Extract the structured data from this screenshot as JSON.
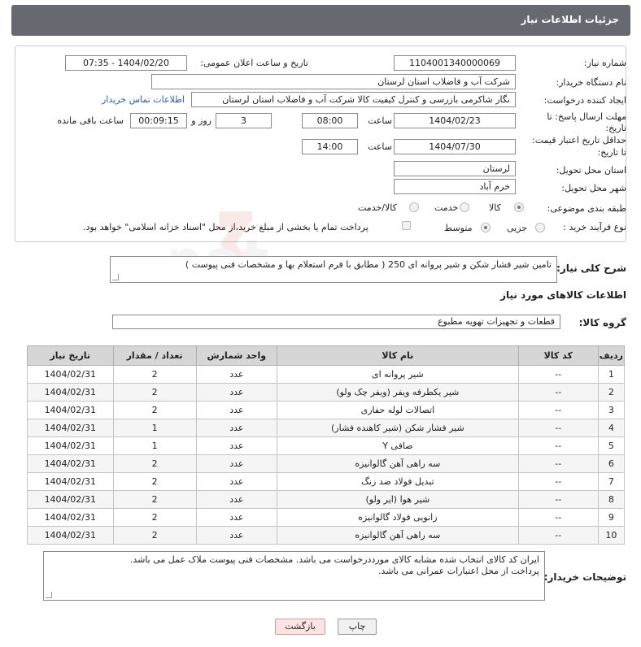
{
  "header": {
    "title": "جزئیات اطلاعات نیاز"
  },
  "form": {
    "need_number_label": "شماره نیاز:",
    "need_number": "1104001340000069",
    "announce_label": "تاریخ و ساعت اعلان عمومی:",
    "announce_value": "1404/02/20 - 07:35",
    "buyer_org_label": "نام دستگاه خریدار:",
    "buyer_org": "شرکت آب و فاضلاب استان لرستان",
    "requester_label": "ایجاد کننده درخواست:",
    "requester": "نگار شاکرمی بازرسی و کنترل کیفیت کالا شرکت آب و فاضلاب استان لرستان",
    "buyer_contact_link": "اطلاعات تماس خریدار",
    "deadline_label_1": "مهلت ارسال پاسخ: تا",
    "deadline_label_2": "تاریخ:",
    "deadline_date": "1404/02/23",
    "time_label": "ساعت",
    "deadline_time": "08:00",
    "days_value": "3",
    "days_label": "روز و",
    "remaining_time": "00:09:15",
    "remaining_label": "ساعت باقی مانده",
    "min_price_label_1": "حداقل تاریخ اعتبار قیمت:",
    "min_price_label_2": "تا تاریخ:",
    "min_price_date": "1404/07/30",
    "min_price_time": "14:00",
    "province_label": "استان محل تحویل:",
    "province": "لرستان",
    "city_label": "شهر محل تحویل:",
    "city": "خرم آباد",
    "category_label": "طبقه بندی موضوعی:",
    "category_options": [
      "کالا",
      "خدمت",
      "کالا/خدمت"
    ],
    "category_selected": "کالا",
    "process_label": "نوع فرآیند خرید :",
    "process_options": [
      "جزیی",
      "متوسط"
    ],
    "process_selected": "متوسط",
    "payment_note": "پرداخت تمام یا بخشی از مبلغ خرید،از محل \"اسناد خزانه اسلامی\" خواهد بود."
  },
  "description": {
    "label": "شرح کلی نیاز:",
    "text": "تامین شیر فشار شکن و شیر پروانه ای 250 ( مطابق با فرم استعلام بها و مشخصات فنی پیوست )"
  },
  "goods_section": {
    "title": "اطلاعات کالاهای مورد نیاز",
    "group_label": "گروه کالا:",
    "group_value": "قطعات و تجهیزات تهویه مطبوع"
  },
  "table": {
    "headers": [
      "ردیف",
      "کد کالا",
      "نام کالا",
      "واحد شمارش",
      "تعداد / مقدار",
      "تاریخ نیاز"
    ],
    "rows": [
      [
        "1",
        "--",
        "شیر پروانه ای",
        "عدد",
        "2",
        "1404/02/31"
      ],
      [
        "2",
        "--",
        "شیر یکطرفه ویفر (ویفر چک ولو)",
        "عدد",
        "2",
        "1404/02/31"
      ],
      [
        "3",
        "--",
        "اتصالات لوله حفاری",
        "عدد",
        "2",
        "1404/02/31"
      ],
      [
        "4",
        "--",
        "شیر فشار شکن (شیر کاهنده فشار)",
        "عدد",
        "1",
        "1404/02/31"
      ],
      [
        "5",
        "--",
        "صافی Y",
        "عدد",
        "1",
        "1404/02/31"
      ],
      [
        "6",
        "--",
        "سه راهی آهن گالوانیزه",
        "عدد",
        "2",
        "1404/02/31"
      ],
      [
        "7",
        "--",
        "تبدیل فولاد ضد زنگ",
        "عدد",
        "2",
        "1404/02/31"
      ],
      [
        "8",
        "--",
        "شیر هوا (ایر ولو)",
        "عدد",
        "2",
        "1404/02/31"
      ],
      [
        "9",
        "--",
        "زانویی فولاد گالوانیزه",
        "عدد",
        "2",
        "1404/02/31"
      ],
      [
        "10",
        "--",
        "سه راهی آهن گالوانیزه",
        "عدد",
        "2",
        "1404/02/31"
      ]
    ]
  },
  "buyer_notes": {
    "label": "توضیحات خریدار:",
    "line1": "ایران کد کالای انتخاب شده مشابه کالای مورددرخواست می باشد. مشخصات فنی پیوست ملاک عمل می باشد.",
    "line2": "پرداخت از محل اعتبارات عمرانی می باشد."
  },
  "buttons": {
    "print": "چاپ",
    "back": "بازگشت"
  },
  "watermark": {
    "text": "AriaTender.net"
  }
}
